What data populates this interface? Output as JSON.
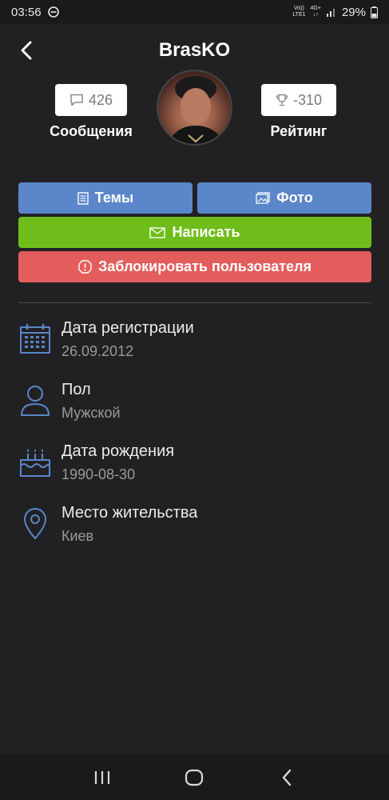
{
  "status_bar": {
    "time": "03:56",
    "network_top": "Vo))",
    "network_bottom": "LTE1",
    "network_type": "4G+",
    "battery": "29%"
  },
  "header": {
    "title": "BrasKO"
  },
  "stats": {
    "messages_count": "426",
    "messages_label": "Сообщения",
    "rating_value": "-310",
    "rating_label": "Рейтинг"
  },
  "buttons": {
    "topics_label": "Темы",
    "photo_label": "Фото",
    "write_label": "Написать",
    "block_label": "Заблокировать пользователя"
  },
  "info": [
    {
      "label": "Дата регистрации",
      "value": "26.09.2012",
      "icon": "calendar-icon"
    },
    {
      "label": "Пол",
      "value": "Мужской",
      "icon": "person-icon"
    },
    {
      "label": "Дата рождения",
      "value": "1990-08-30",
      "icon": "birthday-cake-icon"
    },
    {
      "label": "Место жительства",
      "value": "Киев",
      "icon": "location-pin-icon"
    }
  ],
  "colors": {
    "background": "#212124",
    "topics_button": "#5b86c9",
    "photo_button": "#5b86c9",
    "write_button": "#6fbd1a",
    "block_button": "#e35d5d",
    "info_icon": "#5b86c9"
  }
}
